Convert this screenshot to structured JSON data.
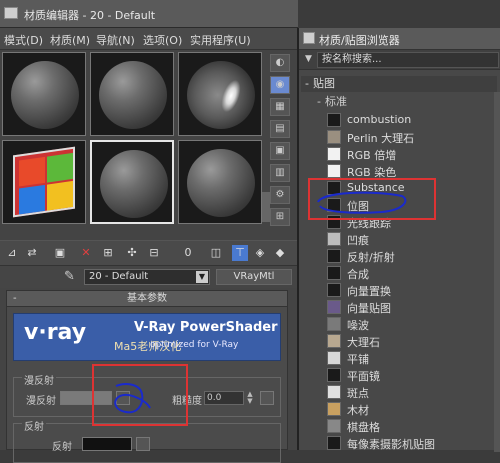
{
  "material_editor": {
    "title": "材质编辑器 - 20 - Default",
    "menu": [
      "模式(D)",
      "材质(M)",
      "导航(N)",
      "选项(O)",
      "实用程序(U)"
    ],
    "material_name": "20 - Default",
    "material_type": "VRayMtl",
    "rollout_title": "基本参数",
    "banner": {
      "logo": "v·ray",
      "product": "V-Ray PowerShader",
      "subtitle": "optimized for V-Ray",
      "watermark": "Ma5老师汉化"
    },
    "diffuse_group_label": "漫反射",
    "diffuse_label": "漫反射",
    "roughness_label": "粗糙度",
    "roughness_value": "0.0",
    "reflection_group_label": "反射",
    "reflect_label": "反射"
  },
  "map_browser": {
    "title": "材质/贴图浏览器",
    "search_placeholder": "按名称搜索...",
    "category": "贴图",
    "subcategory": "标准",
    "items": [
      {
        "name": "combustion",
        "thumb_color": "#1a1a1a"
      },
      {
        "name": "Perlin 大理石",
        "thumb_color": "#9a8f80"
      },
      {
        "name": "RGB 倍增",
        "thumb_color": "#f2f2f2"
      },
      {
        "name": "RGB 染色",
        "thumb_color": "#f2f2f2"
      },
      {
        "name": "Substance",
        "thumb_color": "#1a1a1a"
      },
      {
        "name": "位图",
        "thumb_color": "#1a1a1a"
      },
      {
        "name": "光线跟踪",
        "thumb_color": "#1a1a1a"
      },
      {
        "name": "凹痕",
        "thumb_color": "#bdbdbd"
      },
      {
        "name": "反射/折射",
        "thumb_color": "#1a1a1a"
      },
      {
        "name": "合成",
        "thumb_color": "#1a1a1a"
      },
      {
        "name": "向量置换",
        "thumb_color": "#1a1a1a"
      },
      {
        "name": "向量贴图",
        "thumb_color": "#6a5a8a"
      },
      {
        "name": "噪波",
        "thumb_color": "#7a7a7a"
      },
      {
        "name": "大理石",
        "thumb_color": "#b8a890"
      },
      {
        "name": "平铺",
        "thumb_color": "#d8d8d8"
      },
      {
        "name": "平面镜",
        "thumb_color": "#1a1a1a"
      },
      {
        "name": "斑点",
        "thumb_color": "#e0e0e0"
      },
      {
        "name": "木材",
        "thumb_color": "#c8a060"
      },
      {
        "name": "棋盘格",
        "thumb_color": "#888888"
      },
      {
        "name": "每像素摄影机贴图",
        "thumb_color": "#1a1a1a"
      }
    ]
  },
  "colors": {
    "annotation_red": "#dd3333",
    "annotation_blue": "#1a2acc",
    "vray_blue": "#3a5ea8"
  }
}
